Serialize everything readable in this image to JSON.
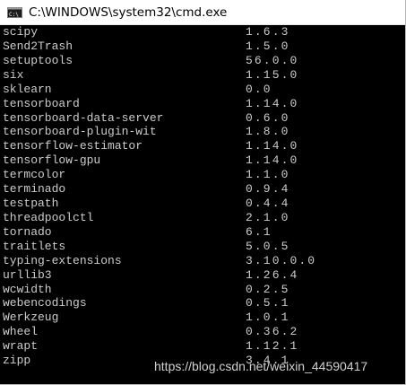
{
  "window": {
    "title": "C:\\WINDOWS\\system32\\cmd.exe",
    "icon": "cmd-console-icon"
  },
  "console": {
    "rows": [
      {
        "name": "scipy",
        "version": "1.6.3"
      },
      {
        "name": "Send2Trash",
        "version": "1.5.0"
      },
      {
        "name": "setuptools",
        "version": "56.0.0"
      },
      {
        "name": "six",
        "version": "1.15.0"
      },
      {
        "name": "sklearn",
        "version": "0.0"
      },
      {
        "name": "tensorboard",
        "version": "1.14.0"
      },
      {
        "name": "tensorboard-data-server",
        "version": "0.6.0"
      },
      {
        "name": "tensorboard-plugin-wit",
        "version": "1.8.0"
      },
      {
        "name": "tensorflow-estimator",
        "version": "1.14.0"
      },
      {
        "name": "tensorflow-gpu",
        "version": "1.14.0"
      },
      {
        "name": "termcolor",
        "version": "1.1.0"
      },
      {
        "name": "terminado",
        "version": "0.9.4"
      },
      {
        "name": "testpath",
        "version": "0.4.4"
      },
      {
        "name": "threadpoolctl",
        "version": "2.1.0"
      },
      {
        "name": "tornado",
        "version": "6.1"
      },
      {
        "name": "traitlets",
        "version": "5.0.5"
      },
      {
        "name": "typing-extensions",
        "version": "3.10.0.0"
      },
      {
        "name": "urllib3",
        "version": "1.26.4"
      },
      {
        "name": "wcwidth",
        "version": "0.2.5"
      },
      {
        "name": "webencodings",
        "version": "0.5.1"
      },
      {
        "name": "Werkzeug",
        "version": "1.0.1"
      },
      {
        "name": "wheel",
        "version": "0.36.2"
      },
      {
        "name": "wrapt",
        "version": "1.12.1"
      },
      {
        "name": "zipp",
        "version": "3.4.1"
      }
    ]
  },
  "watermark": "https://blog.csdn.net/weixin_44590417",
  "colors": {
    "console_background": "#000000",
    "console_text": "#cccccc",
    "titlebar_background": "#ffffff"
  }
}
